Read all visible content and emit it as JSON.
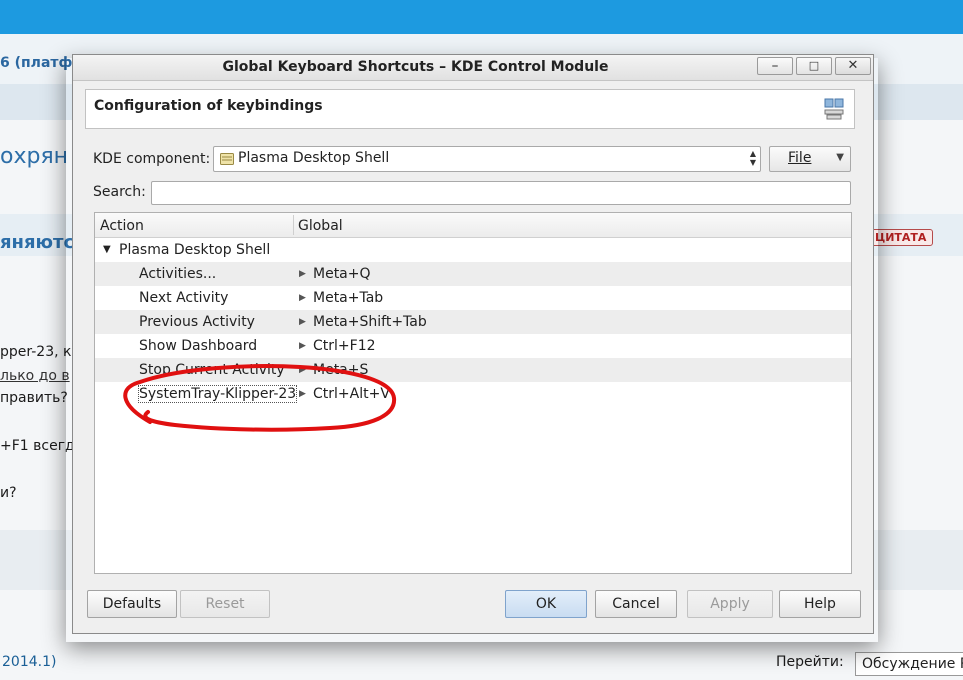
{
  "background": {
    "breadcrumb_fragment": "6 (платф",
    "heading_fragment": "охрян",
    "subheading_fragment": "яняютс",
    "quote_badge": "ЦИТАТА",
    "line1": "pper-23, к",
    "line2": "лько до в",
    "line3": "править?",
    "line4": "+F1 всегд",
    "line5": "и?",
    "footer_left": "2014.1)",
    "goto_label": "Перейти:",
    "goto_value": "Обсуждение R"
  },
  "dialog": {
    "title": "Global Keyboard Shortcuts – KDE Control Module",
    "header": "Configuration of keybindings",
    "component_label": "KDE component:",
    "component_value": "Plasma Desktop Shell",
    "file_label": "File",
    "search_label": "Search:",
    "search_value": "",
    "columns": [
      "Action",
      "Global"
    ],
    "parent": "Plasma Desktop Shell",
    "rows": [
      {
        "action": "Activities...",
        "shortcut": "Meta+Q"
      },
      {
        "action": "Next Activity",
        "shortcut": "Meta+Tab"
      },
      {
        "action": "Previous Activity",
        "shortcut": "Meta+Shift+Tab"
      },
      {
        "action": "Show Dashboard",
        "shortcut": "Ctrl+F12"
      },
      {
        "action": "Stop Current Activity",
        "shortcut": "Meta+S"
      },
      {
        "action": "SystemTray-Klipper-23",
        "shortcut": "Ctrl+Alt+V"
      }
    ],
    "buttons": {
      "defaults": "Defaults",
      "reset": "Reset",
      "ok": "OK",
      "cancel": "Cancel",
      "apply": "Apply",
      "help": "Help"
    }
  },
  "colors": {
    "annotation": "#e01010",
    "page_topbar": "#1d9ae0"
  }
}
